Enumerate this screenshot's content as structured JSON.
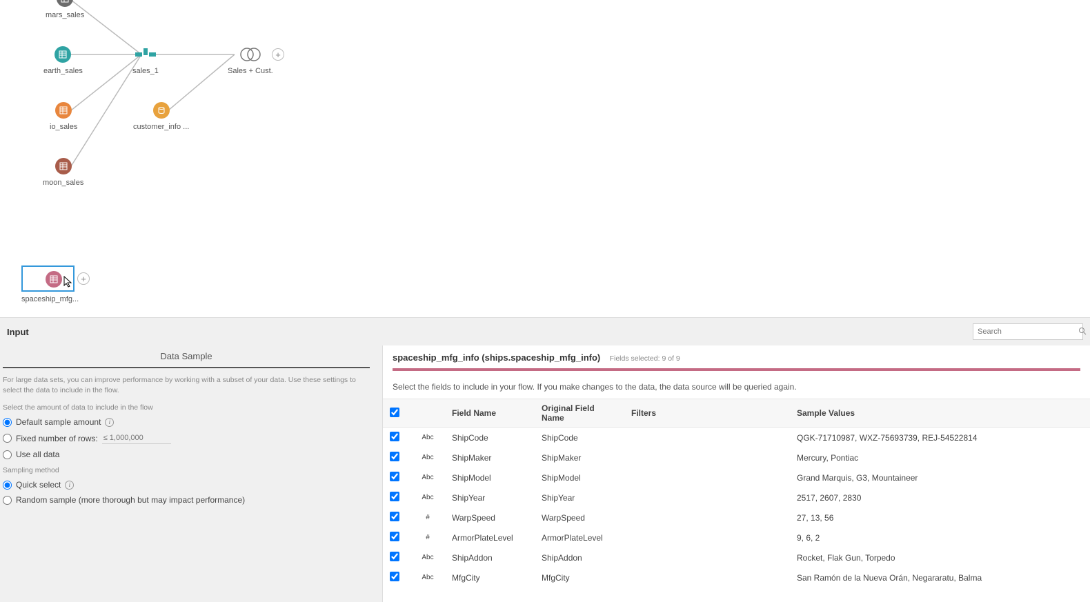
{
  "canvas": {
    "nodes": {
      "mars": {
        "label": "mars_sales",
        "color": "#6b6b6b"
      },
      "earth": {
        "label": "earth_sales",
        "color": "#2fa3a3"
      },
      "io": {
        "label": "io_sales",
        "color": "#e8863d"
      },
      "moon": {
        "label": "moon_sales",
        "color": "#a85c4a"
      },
      "sales1": {
        "label": "sales_1"
      },
      "cust": {
        "label": "customer_info ...",
        "color": "#e8a23d"
      },
      "join": {
        "label": "Sales + Cust."
      },
      "spaceship": {
        "label": "spaceship_mfg...",
        "color": "#c46b84"
      }
    }
  },
  "panel": {
    "title": "Input",
    "search_placeholder": "Search",
    "tab": "Data Sample",
    "help": "For large data sets, you can improve performance by working with a subset of your data. Use these settings to select the data to include in the flow.",
    "amount_label": "Select the amount of data to include in the flow",
    "opt_default": "Default sample amount",
    "opt_fixed": "Fixed number of rows:",
    "fixed_placeholder": "≤ 1,000,000",
    "opt_all": "Use all data",
    "sampling_label": "Sampling method",
    "opt_quick": "Quick select",
    "opt_random": "Random sample (more thorough but may impact performance)"
  },
  "right": {
    "title": "spaceship_mfg_info (ships.spaceship_mfg_info)",
    "selected": "Fields selected: 9 of 9",
    "instr": "Select the fields to include in your flow. If you make changes to the data, the data source will be queried again.",
    "headers": {
      "field": "Field Name",
      "orig": "Original Field Name",
      "filters": "Filters",
      "samples": "Sample Values"
    },
    "rows": [
      {
        "type": "Abc",
        "name": "ShipCode",
        "orig": "ShipCode",
        "sample": "QGK-71710987, WXZ-75693739, REJ-54522814"
      },
      {
        "type": "Abc",
        "name": "ShipMaker",
        "orig": "ShipMaker",
        "sample": "Mercury, Pontiac"
      },
      {
        "type": "Abc",
        "name": "ShipModel",
        "orig": "ShipModel",
        "sample": "Grand Marquis, G3, Mountaineer"
      },
      {
        "type": "Abc",
        "name": "ShipYear",
        "orig": "ShipYear",
        "sample": "2517, 2607, 2830"
      },
      {
        "type": "#",
        "name": "WarpSpeed",
        "orig": "WarpSpeed",
        "sample": "27, 13, 56"
      },
      {
        "type": "#",
        "name": "ArmorPlateLevel",
        "orig": "ArmorPlateLevel",
        "sample": "9, 6, 2"
      },
      {
        "type": "Abc",
        "name": "ShipAddon",
        "orig": "ShipAddon",
        "sample": "Rocket, Flak Gun, Torpedo"
      },
      {
        "type": "Abc",
        "name": "MfgCity",
        "orig": "MfgCity",
        "sample": "San Ramón de la Nueva Orán, Negararatu, Balma"
      }
    ]
  }
}
